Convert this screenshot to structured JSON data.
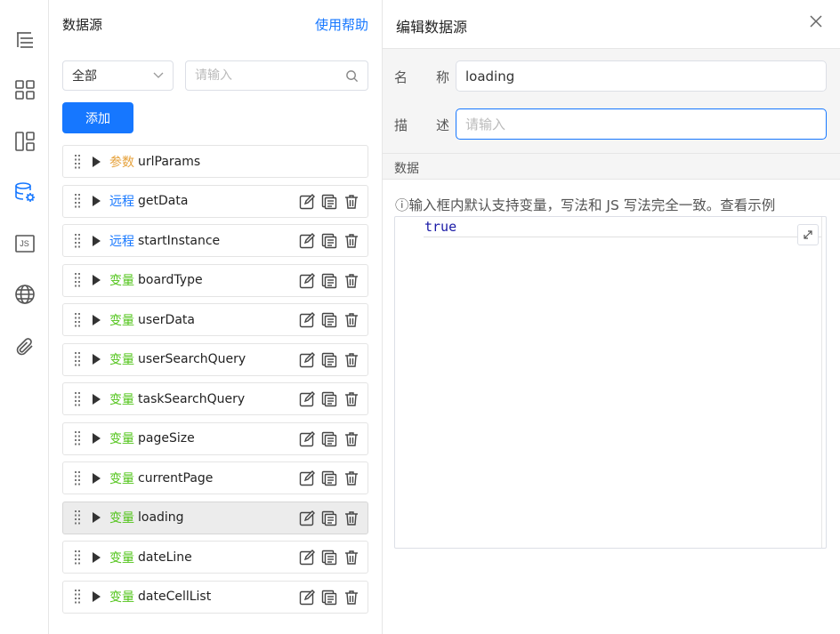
{
  "rail": {
    "items": [
      {
        "name": "outline-icon"
      },
      {
        "name": "components-icon"
      },
      {
        "name": "layout-icon"
      },
      {
        "name": "datasource-icon"
      },
      {
        "name": "js-icon",
        "label": "JS"
      },
      {
        "name": "globe-icon"
      },
      {
        "name": "attachment-icon"
      }
    ]
  },
  "datasource": {
    "title": "数据源",
    "help_link": "使用帮助",
    "scope_select": "全部",
    "search_placeholder": "请输入",
    "add_button": "添加",
    "items": [
      {
        "tag": "参数",
        "kind": "param",
        "name": "urlParams",
        "actions": false
      },
      {
        "tag": "远程",
        "kind": "remote",
        "name": "getData",
        "actions": true
      },
      {
        "tag": "远程",
        "kind": "remote",
        "name": "startInstance",
        "actions": true
      },
      {
        "tag": "变量",
        "kind": "var",
        "name": "boardType",
        "actions": true
      },
      {
        "tag": "变量",
        "kind": "var",
        "name": "userData",
        "actions": true
      },
      {
        "tag": "变量",
        "kind": "var",
        "name": "userSearchQuery",
        "actions": true
      },
      {
        "tag": "变量",
        "kind": "var",
        "name": "taskSearchQuery",
        "actions": true
      },
      {
        "tag": "变量",
        "kind": "var",
        "name": "pageSize",
        "actions": true
      },
      {
        "tag": "变量",
        "kind": "var",
        "name": "currentPage",
        "actions": true
      },
      {
        "tag": "变量",
        "kind": "var",
        "name": "loading",
        "actions": true,
        "selected": true
      },
      {
        "tag": "变量",
        "kind": "var",
        "name": "dateLine",
        "actions": true
      },
      {
        "tag": "变量",
        "kind": "var",
        "name": "dateCellList",
        "actions": true
      }
    ]
  },
  "editor": {
    "title": "编辑数据源",
    "name_label_a": "名",
    "name_label_b": "称",
    "name_value": "loading",
    "desc_label_a": "描",
    "desc_label_b": "述",
    "desc_placeholder": "请输入",
    "section_label": "数据",
    "hint": "ⓘ输入框内默认支持变量，写法和 JS 写法完全一致。查看示例",
    "code": "true"
  },
  "colors": {
    "accent": "#1677ff",
    "param": "#e6a23c",
    "remote": "#1677ff",
    "var": "#52c41a"
  }
}
